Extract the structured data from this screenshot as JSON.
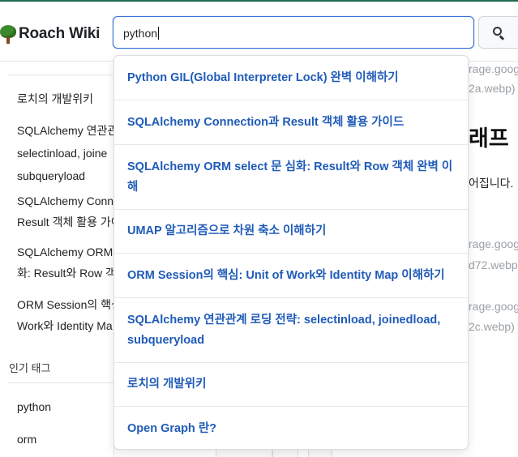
{
  "header": {
    "brand": "Roach Wiki",
    "logo_icon": "tree-icon",
    "accent_color": "#1e6b52"
  },
  "search": {
    "value": "python",
    "button_icon": "search-icon"
  },
  "sidebar": {
    "items": [
      {
        "lines": [
          "로치의 개발위키"
        ]
      },
      {
        "lines": [
          "SQLAlchemy 연관관",
          "selectinload, joine",
          "subqueryload"
        ]
      },
      {
        "lines": [
          "SQLAlchemy Conn",
          "Result 객체 활용 가이"
        ]
      },
      {
        "lines": [
          "SQLAlchemy ORM",
          "화: Result와 Row 객"
        ]
      },
      {
        "lines": [
          "ORM Session의 핵심",
          "Work와 Identity Ma"
        ]
      }
    ],
    "tags_heading": "인기 태그",
    "tags": [
      "python",
      "orm"
    ]
  },
  "main": {
    "img1": [
      "rage.goog",
      "2a.webp)"
    ],
    "heading": "래프",
    "text": "어집니다.",
    "img2": [
      "rage.goog",
      "d72.webp"
    ],
    "img3": [
      "rage.goog",
      "2c.webp)"
    ]
  },
  "suggestions": [
    {
      "text": "Python GIL(Global Interpreter Lock) 완벽 이해하기"
    },
    {
      "text": "SQLAlchemy Connection과 Result 객체 활용 가이드"
    },
    {
      "text": "SQLAlchemy ORM select 문 심화: Result와 Row 객체 완벽 이해"
    },
    {
      "text": "UMAP 알고리즘으로 차원 축소 이해하기"
    },
    {
      "text": "ORM Session의 핵심: Unit of Work와 Identity Map 이해하기"
    },
    {
      "text": "SQLAlchemy 연관관계 로딩 전략: selectinload, joinedload, subqueryload"
    },
    {
      "text": "로치의 개발위키"
    },
    {
      "text": "Open Graph 란?"
    }
  ],
  "colors": {
    "link": "#1f5bb8",
    "focus_border": "#2f6fd8"
  }
}
